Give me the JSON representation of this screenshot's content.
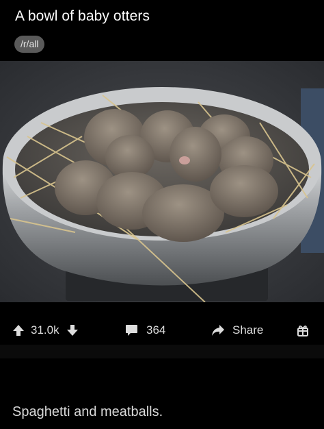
{
  "post": {
    "title": "A bowl of baby otters",
    "subreddit": "/r/all"
  },
  "actions": {
    "score": "31.0k",
    "comments": "364",
    "share_label": "Share"
  },
  "comment": {
    "text": "Spaghetti and meatballs."
  },
  "icons": {
    "upvote": "arrow-up-icon",
    "downvote": "arrow-down-icon",
    "comments": "speech-bubble-icon",
    "share": "share-arrow-icon",
    "award": "gift-icon"
  },
  "colors": {
    "background": "#000000",
    "chip": "#5a5a5a",
    "icon": "#dddddd"
  }
}
